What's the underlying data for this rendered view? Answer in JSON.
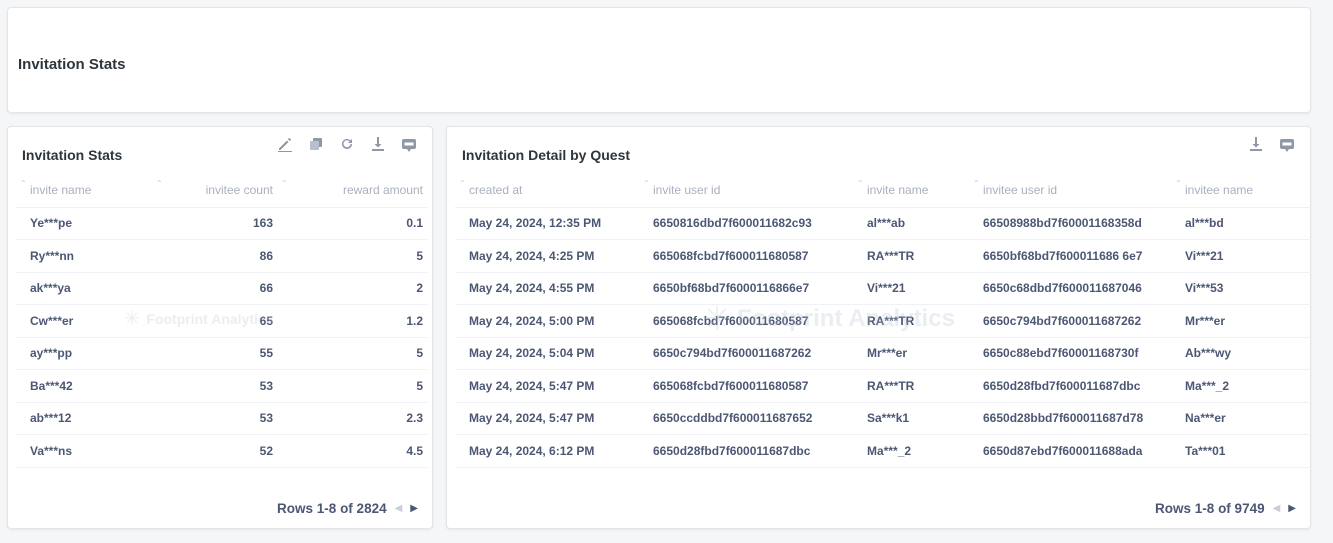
{
  "header": {
    "title": "Invitation Stats"
  },
  "watermark": {
    "text": "Footprint Analytics"
  },
  "stats": {
    "title": "Invitation Stats",
    "columns": [
      "invite name",
      "invitee count",
      "reward amount"
    ],
    "rows": [
      [
        "Ye***pe",
        "163",
        "0.1"
      ],
      [
        "Ry***nn",
        "86",
        "5"
      ],
      [
        "ak***ya",
        "66",
        "2"
      ],
      [
        "Cw***er",
        "65",
        "1.2"
      ],
      [
        "ay***pp",
        "55",
        "5"
      ],
      [
        "Ba***42",
        "53",
        "5"
      ],
      [
        "ab***12",
        "53",
        "2.3"
      ],
      [
        "Va***ns",
        "52",
        "4.5"
      ]
    ],
    "pager": "Rows 1-8 of 2824",
    "toolbar": [
      "edit-icon",
      "duplicate-icon",
      "refresh-icon",
      "download-icon",
      "api-icon"
    ]
  },
  "detail": {
    "title": "Invitation Detail by Quest",
    "columns": [
      "created at",
      "invite user id",
      "invite name",
      "invitee user id",
      "invitee name"
    ],
    "rows": [
      [
        "May 24, 2024, 12:35 PM",
        "6650816dbd7f600011682c93",
        "al***ab",
        "66508988bd7f60001168358d",
        "al***bd"
      ],
      [
        "May 24, 2024, 4:25 PM",
        "665068fcbd7f600011680587",
        "RA***TR",
        "6650bf68bd7f600011686 6e7",
        "Vi***21"
      ],
      [
        "May 24, 2024, 4:55 PM",
        "6650bf68bd7f6000116866e7",
        "Vi***21",
        "6650c68dbd7f600011687046",
        "Vi***53"
      ],
      [
        "May 24, 2024, 5:00 PM",
        "665068fcbd7f600011680587",
        "RA***TR",
        "6650c794bd7f600011687262",
        "Mr***er"
      ],
      [
        "May 24, 2024, 5:04 PM",
        "6650c794bd7f600011687262",
        "Mr***er",
        "6650c88ebd7f60001168730f",
        "Ab***wy"
      ],
      [
        "May 24, 2024, 5:47 PM",
        "665068fcbd7f600011680587",
        "RA***TR",
        "6650d28fbd7f600011687dbc",
        "Ma***_2"
      ],
      [
        "May 24, 2024, 5:47 PM",
        "6650ccddbd7f600011687652",
        "Sa***k1",
        "6650d28bbd7f600011687d78",
        "Na***er"
      ],
      [
        "May 24, 2024, 6:12 PM",
        "6650d28fbd7f600011687dbc",
        "Ma***_2",
        "6650d87ebd7f600011688ada",
        "Ta***01"
      ]
    ],
    "pager": "Rows 1-8 of 9749",
    "toolbar": [
      "download-icon",
      "api-icon"
    ]
  },
  "colors": {
    "text": "#4c5773",
    "muted": "#a9b0bf",
    "icon": "#8f97a8"
  }
}
